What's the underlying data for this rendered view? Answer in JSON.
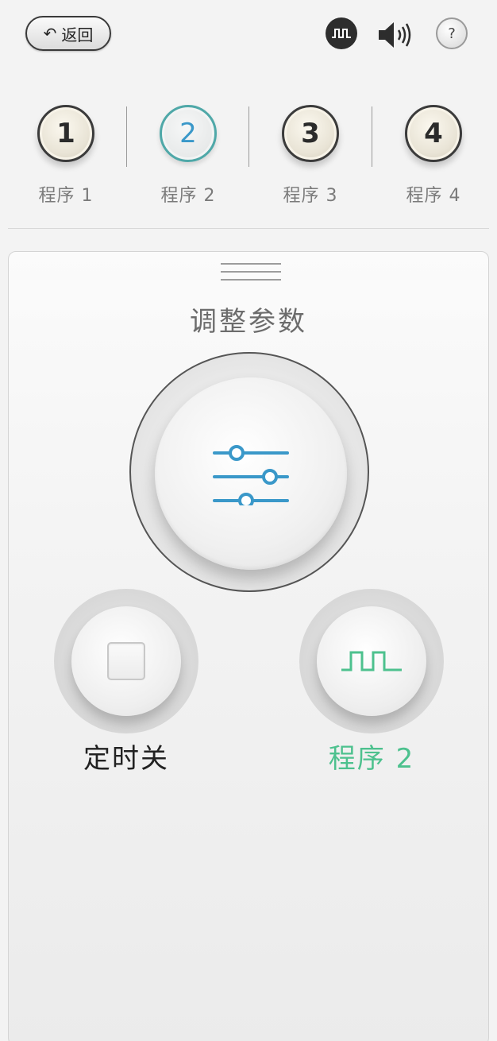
{
  "header": {
    "back_label": "返回",
    "back_icon": "return-arrow-icon",
    "wave_icon": "pulse-wave-icon",
    "speaker_icon": "speaker-icon",
    "help_label": "?"
  },
  "programs": [
    {
      "number": "1",
      "label": "程序 1",
      "active": false
    },
    {
      "number": "2",
      "label": "程序 2",
      "active": true
    },
    {
      "number": "3",
      "label": "程序 3",
      "active": false
    },
    {
      "number": "4",
      "label": "程序 4",
      "active": false
    }
  ],
  "panel": {
    "title": "调整参数",
    "adjust_icon": "sliders-icon",
    "timer_label": "定时关",
    "timer_icon": "stop-square-icon",
    "program_label": "程序 2",
    "program_icon": "pulse-wave-icon"
  },
  "colors": {
    "accent_blue": "#3a98c9",
    "accent_green": "#4dc18e",
    "active_ring": "#4fa8a8"
  }
}
